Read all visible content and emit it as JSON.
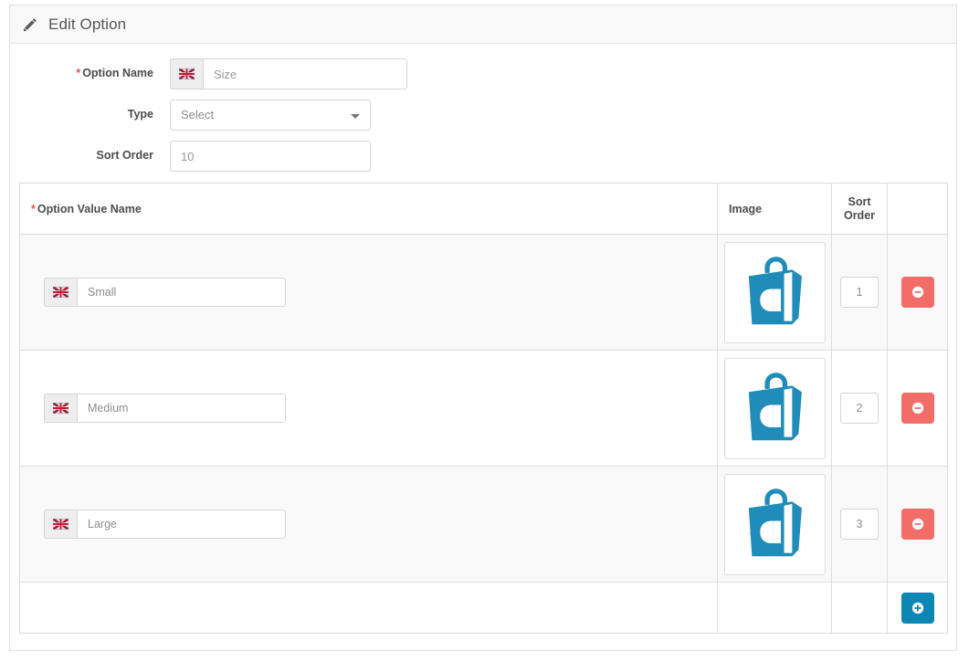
{
  "panel": {
    "title": "Edit Option",
    "icon": "pencil-icon"
  },
  "form": {
    "option_name": {
      "label": "Option Name",
      "required_mark": "*",
      "value": "Size",
      "placeholder": "Size",
      "flag_icon": "uk-flag-icon"
    },
    "type": {
      "label": "Type",
      "value": "Select",
      "caret_icon": "chevron-down-icon"
    },
    "sort_order": {
      "label": "Sort Order",
      "value": "10",
      "placeholder": "10"
    }
  },
  "values_table": {
    "headers": {
      "name": "Option Value Name",
      "name_required_mark": "*",
      "image": "Image",
      "sort_order_line1": "Sort",
      "sort_order_line2": "Order",
      "actions": ""
    },
    "rows": [
      {
        "name": "Small",
        "flag_icon": "uk-flag-icon",
        "image_icon": "abantecart-bag-logo",
        "sort_order": "1",
        "remove_icon": "minus-circle-icon"
      },
      {
        "name": "Medium",
        "flag_icon": "uk-flag-icon",
        "image_icon": "abantecart-bag-logo",
        "sort_order": "2",
        "remove_icon": "minus-circle-icon"
      },
      {
        "name": "Large",
        "flag_icon": "uk-flag-icon",
        "image_icon": "abantecart-bag-logo",
        "sort_order": "3",
        "remove_icon": "minus-circle-icon"
      }
    ],
    "add_row": {
      "add_icon": "plus-circle-icon"
    }
  },
  "colors": {
    "accent_blue": "#0c87b3",
    "danger_red": "#f26c68",
    "required_red": "#e8564a",
    "logo_blue": "#1f8cba",
    "row_stripe": "#f9f9f9",
    "border": "#dddddd"
  }
}
